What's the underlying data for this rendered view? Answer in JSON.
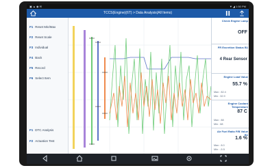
{
  "status": {
    "left": "▣ ▲ ◉ ✉",
    "right": "▼ ◢ 1:50 PM"
  },
  "header": {
    "title": "TCCS(Engine)(6T) > Data Analysis(All Items)"
  },
  "sidebar": {
    "items": [
      {
        "key": "F1",
        "label": "Reset Min/Max"
      },
      {
        "key": "F2",
        "label": "Reset Scale"
      },
      {
        "key": "F3",
        "label": "Individual"
      },
      {
        "key": "F4",
        "label": "Back"
      },
      {
        "key": "F5",
        "label": "Record"
      },
      {
        "key": "F6",
        "label": "Select Item"
      }
    ],
    "bottom_items": [
      {
        "key": "F1",
        "label": "DTC Analysis"
      },
      {
        "key": "F2",
        "label": "Actuation Test"
      }
    ]
  },
  "cards": [
    {
      "title": "Check Engine Lamp",
      "value": "OFF",
      "min": "",
      "max": ""
    },
    {
      "title": "FR Excretion Status B1",
      "value": "4 Rear Sensor",
      "min": "",
      "max": ""
    },
    {
      "title": "Engine Load Value",
      "value": "55.7 %",
      "max": "Max : 82.4",
      "min": "Min : 32.9"
    },
    {
      "title": "Engine Coolant Temperature",
      "value": "87 C",
      "max": "Max : 88",
      "min": "Min : 68"
    },
    {
      "title": "Air Fuel Ratio F/B Value B1",
      "value": "1.6 %",
      "max": "Max : 8.0",
      "min": "Min : -5.5"
    }
  ],
  "icons": {
    "home": "home-icon",
    "pause": "pause-icon",
    "export": "export-icon",
    "back": "nav-back-icon",
    "nav_home": "nav-home-icon",
    "recent": "nav-recent-icon",
    "gallery": "gallery-icon",
    "settings": "gear-icon",
    "fullscreen": "fullscreen-icon"
  },
  "colors": {
    "header": "#1d5aa8",
    "line_green": "#6ccb77",
    "line_orange": "#ef8a4c",
    "line_blue": "#5b72c7",
    "bar_yellow": "#f2d35b",
    "bar_purple": "#a884d9"
  }
}
